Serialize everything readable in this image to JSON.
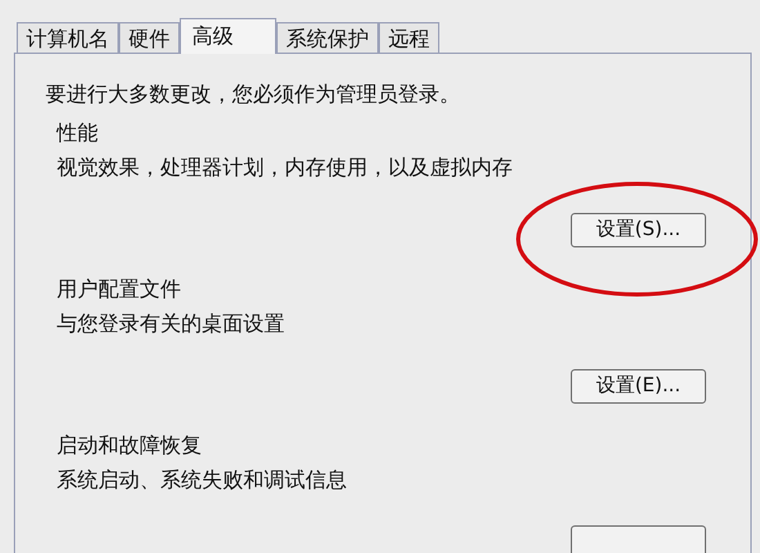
{
  "tabs": [
    {
      "label": "计算机名",
      "selected": false
    },
    {
      "label": "硬件",
      "selected": false
    },
    {
      "label": "高级",
      "selected": true
    },
    {
      "label": "系统保护",
      "selected": false
    },
    {
      "label": "远程",
      "selected": false
    }
  ],
  "notice": "要进行大多数更改，您必须作为管理员登录。",
  "sections": [
    {
      "title": "性能",
      "description": "视觉效果，处理器计划，内存使用，以及虚拟内存",
      "button": "设置(S)...",
      "annotated": true
    },
    {
      "title": "用户配置文件",
      "description": "与您登录有关的桌面设置",
      "button": "设置(E)...",
      "annotated": false
    },
    {
      "title": "启动和故障恢复",
      "description": "系统启动、系统失败和调试信息",
      "annotated": false
    }
  ]
}
